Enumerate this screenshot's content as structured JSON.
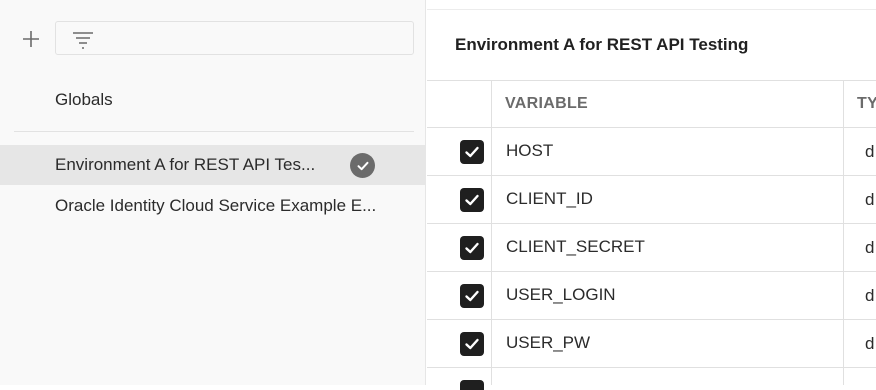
{
  "sidebar": {
    "add_icon": "plus-icon",
    "filter_icon": "filter-icon",
    "items": [
      {
        "label": "Globals",
        "active": false
      },
      {
        "label": "Environment A for REST API Tes...",
        "active": true,
        "badge_icon": "checkmark-circle-icon"
      },
      {
        "label": "Oracle Identity Cloud Service Example E...",
        "active": false
      }
    ]
  },
  "main": {
    "title": "Environment A for REST API Testing",
    "columns": {
      "variable": "VARIABLE",
      "type": "TY"
    },
    "rows": [
      {
        "checked": true,
        "variable": "HOST",
        "type": "d"
      },
      {
        "checked": true,
        "variable": "CLIENT_ID",
        "type": "d"
      },
      {
        "checked": true,
        "variable": "CLIENT_SECRET",
        "type": "d"
      },
      {
        "checked": true,
        "variable": "USER_LOGIN",
        "type": "d"
      },
      {
        "checked": true,
        "variable": "USER_PW",
        "type": "d"
      }
    ]
  },
  "colors": {
    "sidebar_bg": "#f9f9f9",
    "active_item_bg": "#e6e6e6",
    "checkbox": "#1f1f1f",
    "badge": "#6b6b6b",
    "header_text": "#6b6b6b"
  }
}
